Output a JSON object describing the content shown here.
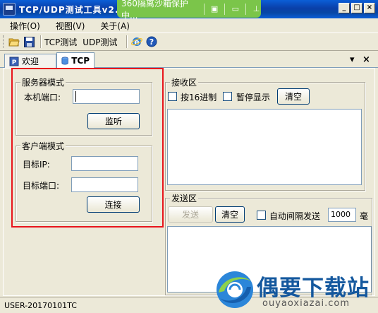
{
  "window": {
    "title": "TCP/UDP测试工具v2.1"
  },
  "sandbox_banner": {
    "text": "360隔离沙箱保护中..."
  },
  "menu": {
    "items": [
      "操作(O)",
      "视图(V)",
      "关于(A)"
    ]
  },
  "toolbar": {
    "tcp_label": "TCP测试",
    "udp_label": "UDP测试"
  },
  "tabs": {
    "welcome": "欢迎",
    "tcp": "TCP",
    "close": "×"
  },
  "server": {
    "group_title": "服务器模式",
    "port_label": "本机端口:",
    "port_value": "",
    "listen_button": "监听"
  },
  "client": {
    "group_title": "客户端模式",
    "ip_label": "目标IP:",
    "ip_value": "",
    "port_label": "目标端口:",
    "port_value": "",
    "connect_button": "连接"
  },
  "receive": {
    "group_title": "接收区",
    "hex_label": "按16进制",
    "pause_label": "暂停显示",
    "clear_button": "清空"
  },
  "send": {
    "group_title": "发送区",
    "send_button": "发送",
    "clear_button": "清空",
    "auto_label": "自动间隔发送",
    "interval_value": "1000",
    "unit_label": "毫"
  },
  "status": {
    "text": "USER-20170101TC"
  },
  "watermark": {
    "brand": "偶要下载站",
    "url": "ouyaoxiazai.com"
  },
  "colors": {
    "title_bar": "#0a3fa8",
    "highlight": "#e8151c",
    "sandbox": "#7bc54a"
  }
}
